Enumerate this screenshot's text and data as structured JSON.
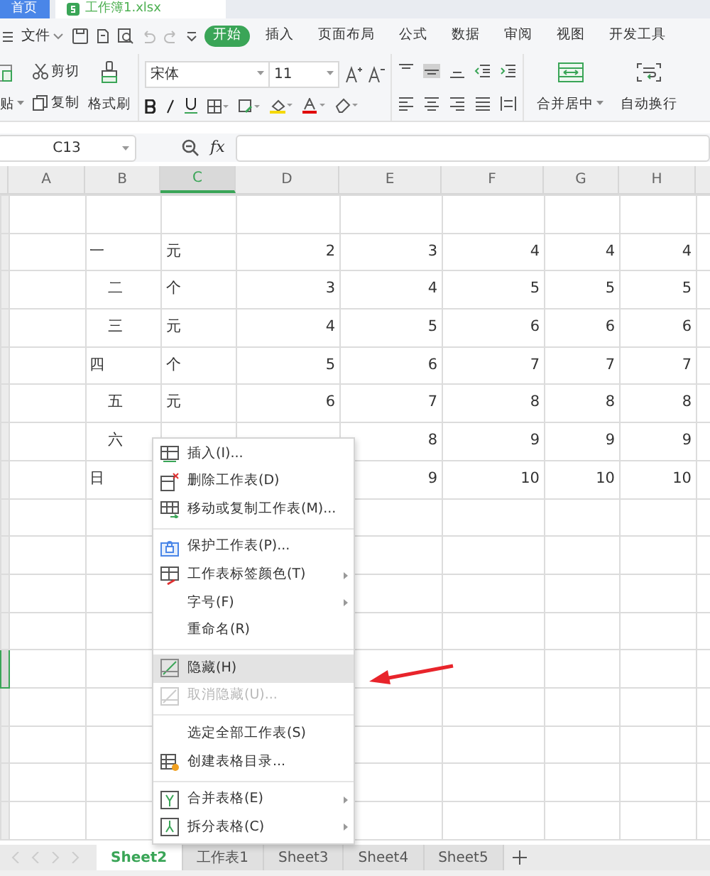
{
  "app_tabs": [
    {
      "label": "首页",
      "selected": true
    },
    {
      "label": "工作簿1.xlsx",
      "selected": false
    }
  ],
  "menu_bar": {
    "file": "文件",
    "tabs": [
      {
        "label": "开始",
        "selected": true
      },
      {
        "label": "插入",
        "selected": false
      },
      {
        "label": "页面布局",
        "selected": false
      },
      {
        "label": "公式",
        "selected": false
      },
      {
        "label": "数据",
        "selected": false
      },
      {
        "label": "审阅",
        "selected": false
      },
      {
        "label": "视图",
        "selected": false
      },
      {
        "label": "开发工具",
        "selected": false
      }
    ]
  },
  "ribbon": {
    "paste": "贴",
    "cut": "剪切",
    "copy": "复制",
    "format_painter": "格式刷",
    "font": "宋体",
    "size": "11",
    "merge": "合并居中",
    "wrap": "自动换行"
  },
  "formula_bar": {
    "name_box": "C13",
    "fx": "fx"
  },
  "sheet": {
    "columns": [
      {
        "label": "A",
        "selected": false
      },
      {
        "label": "B",
        "selected": false
      },
      {
        "label": "C",
        "selected": true
      },
      {
        "label": "D",
        "selected": false
      },
      {
        "label": "E",
        "selected": false
      },
      {
        "label": "F",
        "selected": false
      },
      {
        "label": "G",
        "selected": false
      },
      {
        "label": "H",
        "selected": false
      }
    ],
    "rows": [
      {
        "selected": false
      },
      {
        "selected": false,
        "label": "一",
        "indented": false,
        "unit": "元",
        "values": {
          "D": "2",
          "E": "3",
          "F": "4",
          "G": "4",
          "H": "4"
        }
      },
      {
        "selected": false,
        "label": "二",
        "indented": true,
        "unit": "个",
        "values": {
          "D": "3",
          "E": "4",
          "F": "5",
          "G": "5",
          "H": "5"
        }
      },
      {
        "selected": false,
        "label": "三",
        "indented": true,
        "unit": "元",
        "values": {
          "D": "4",
          "E": "5",
          "F": "6",
          "G": "6",
          "H": "6"
        }
      },
      {
        "selected": false,
        "label": "四",
        "indented": false,
        "unit": "个",
        "values": {
          "D": "5",
          "E": "6",
          "F": "7",
          "G": "7",
          "H": "7"
        }
      },
      {
        "selected": false,
        "label": "五",
        "indented": true,
        "unit": "元",
        "values": {
          "D": "6",
          "E": "7",
          "F": "8",
          "G": "8",
          "H": "8"
        }
      },
      {
        "selected": false,
        "label": "六",
        "indented": true,
        "values": {
          "E": "8",
          "F": "9",
          "G": "9",
          "H": "9"
        }
      },
      {
        "selected": false,
        "label": "日",
        "indented": false,
        "values": {
          "E": "9",
          "F": "10",
          "G": "10",
          "H": "10"
        }
      },
      {
        "selected": false
      },
      {
        "selected": false
      },
      {
        "selected": false
      },
      {
        "selected": false
      },
      {
        "selected": true
      },
      {
        "selected": false
      },
      {
        "selected": false
      },
      {
        "selected": false
      },
      {
        "selected": false
      }
    ]
  },
  "context_menu": [
    {
      "kind": "item",
      "label": "插入(I)...",
      "submenu": false,
      "disabled": false,
      "selected": false
    },
    {
      "kind": "item",
      "label": "删除工作表(D)",
      "submenu": false,
      "disabled": false,
      "selected": false
    },
    {
      "kind": "item",
      "label": "移动或复制工作表(M)...",
      "submenu": false,
      "disabled": false,
      "selected": false
    },
    {
      "kind": "separator"
    },
    {
      "kind": "item",
      "label": "保护工作表(P)...",
      "submenu": false,
      "disabled": false,
      "selected": false
    },
    {
      "kind": "item",
      "label": "工作表标签颜色(T)",
      "submenu": true,
      "disabled": false,
      "selected": false
    },
    {
      "kind": "item",
      "label": "字号(F)",
      "submenu": true,
      "disabled": false,
      "selected": false
    },
    {
      "kind": "item",
      "label": "重命名(R)",
      "submenu": false,
      "disabled": false,
      "selected": false
    },
    {
      "kind": "separator"
    },
    {
      "kind": "item",
      "label": "隐藏(H)",
      "submenu": false,
      "disabled": false,
      "selected": true
    },
    {
      "kind": "item",
      "label": "取消隐藏(U)...",
      "submenu": false,
      "disabled": true,
      "selected": false
    },
    {
      "kind": "separator"
    },
    {
      "kind": "item",
      "label": "选定全部工作表(S)",
      "submenu": false,
      "disabled": false,
      "selected": false
    },
    {
      "kind": "item",
      "label": "创建表格目录...",
      "submenu": false,
      "disabled": false,
      "selected": false
    },
    {
      "kind": "separator"
    },
    {
      "kind": "item",
      "label": "合并表格(E)",
      "submenu": true,
      "disabled": false,
      "selected": false
    },
    {
      "kind": "item",
      "label": "拆分表格(C)",
      "submenu": true,
      "disabled": false,
      "selected": false
    }
  ],
  "sheet_tabs": [
    {
      "label": "Sheet2",
      "selected": true
    },
    {
      "label": "工作表1",
      "selected": false
    },
    {
      "label": "Sheet3",
      "selected": false
    },
    {
      "label": "Sheet4",
      "selected": false
    },
    {
      "label": "Sheet5",
      "selected": false
    }
  ]
}
